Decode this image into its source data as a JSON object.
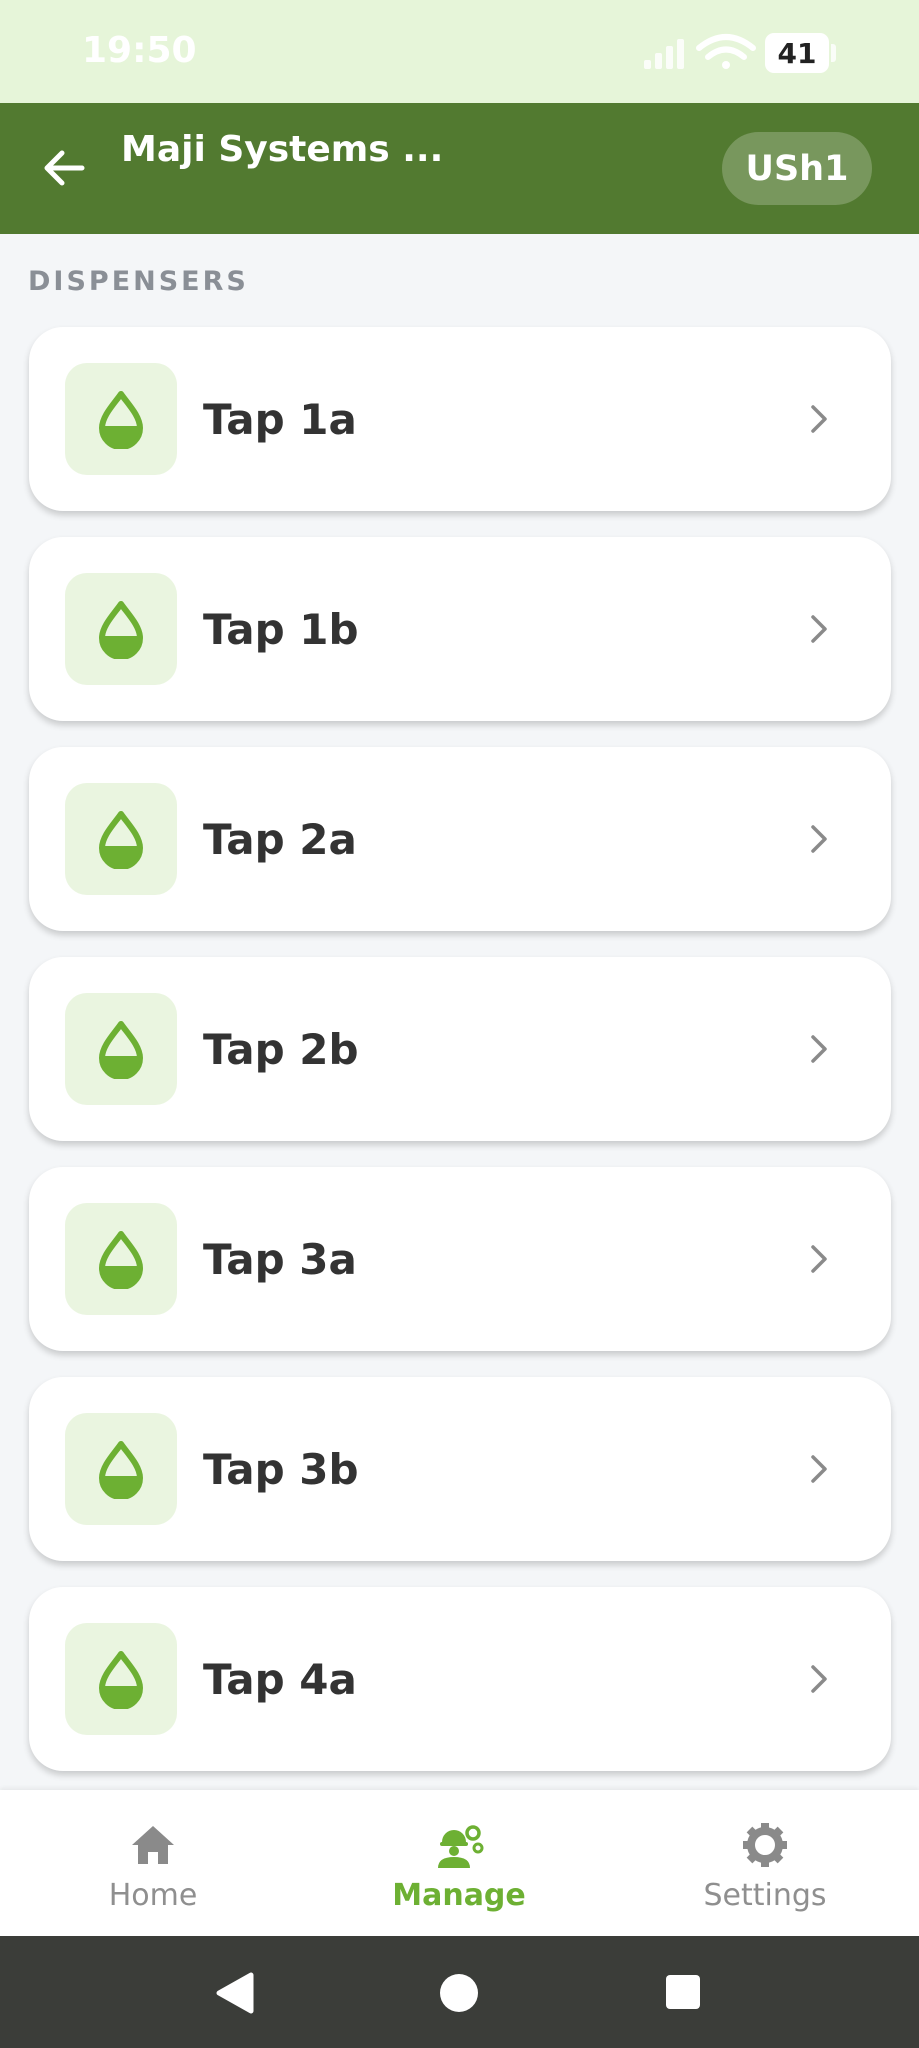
{
  "status_bar": {
    "time": "19:50",
    "battery": "41"
  },
  "header": {
    "title": "Maji Systems ...",
    "currency_chip": "USh1"
  },
  "section": {
    "label": "DISPENSERS"
  },
  "dispensers": [
    {
      "name": "Tap 1a"
    },
    {
      "name": "Tap 1b"
    },
    {
      "name": "Tap 2a"
    },
    {
      "name": "Tap 2b"
    },
    {
      "name": "Tap 3a"
    },
    {
      "name": "Tap 3b"
    },
    {
      "name": "Tap 4a"
    }
  ],
  "bottom_nav": {
    "items": [
      {
        "label": "Home",
        "icon": "home-icon",
        "active": false
      },
      {
        "label": "Manage",
        "icon": "manage-icon",
        "active": true
      },
      {
        "label": "Settings",
        "icon": "gear-icon",
        "active": false
      }
    ]
  },
  "colors": {
    "app_bar": "#527a30",
    "status_bar": "#e6f5d9",
    "accent": "#6db033",
    "icon_bg": "#eaf5e0",
    "system_nav": "#3b3d39"
  }
}
